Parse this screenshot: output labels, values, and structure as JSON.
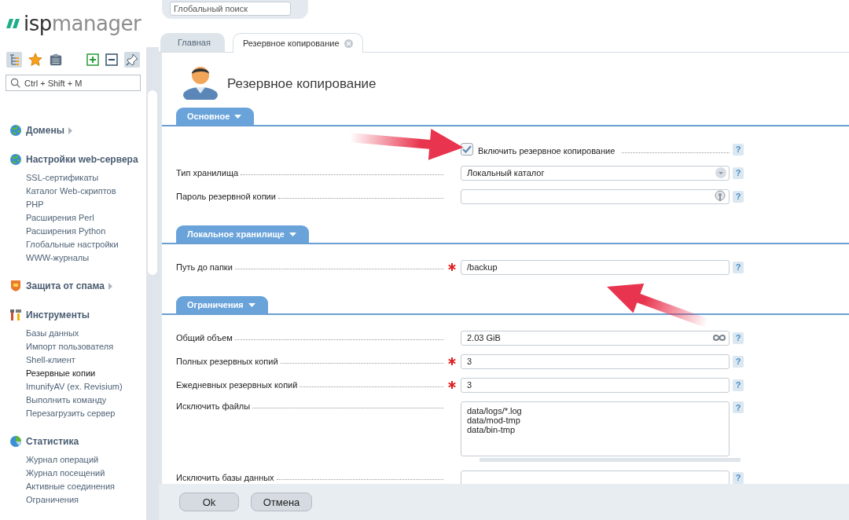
{
  "logo": {
    "accent": "isp",
    "rest": "manager"
  },
  "sidebar": {
    "search": {
      "placeholder": "Ctrl + Shift + M"
    },
    "groups": [
      {
        "title": "Домены",
        "expanded": false
      },
      {
        "title": "Настройки web-сервера",
        "expanded": true,
        "items": [
          {
            "label": "SSL-сертификаты",
            "selected": false
          },
          {
            "label": "Каталог Web-скриптов",
            "selected": false
          },
          {
            "label": "PHP",
            "selected": false
          },
          {
            "label": "Расширения Perl",
            "selected": false
          },
          {
            "label": "Расширения Python",
            "selected": false
          },
          {
            "label": "Глобальные настройки",
            "selected": false
          },
          {
            "label": "WWW-журналы",
            "selected": false
          }
        ]
      },
      {
        "title": "Защита от спама",
        "expanded": false
      },
      {
        "title": "Инструменты",
        "expanded": true,
        "items": [
          {
            "label": "Базы данных",
            "selected": false
          },
          {
            "label": "Импорт пользователя",
            "selected": false
          },
          {
            "label": "Shell-клиент",
            "selected": false
          },
          {
            "label": "Резервные копии",
            "selected": true
          },
          {
            "label": "ImunifyAV (ex. Revisium)",
            "selected": false
          },
          {
            "label": "Выполнить команду",
            "selected": false
          },
          {
            "label": "Перезагрузить сервер",
            "selected": false
          }
        ]
      },
      {
        "title": "Статистика",
        "expanded": true,
        "items": [
          {
            "label": "Журнал операций",
            "selected": false
          },
          {
            "label": "Журнал посещений",
            "selected": false
          },
          {
            "label": "Активные соединения",
            "selected": false
          },
          {
            "label": "Ограничения",
            "selected": false
          }
        ]
      }
    ]
  },
  "global_search": {
    "placeholder": "Глобальный поиск"
  },
  "tabs": [
    {
      "label": "Главная",
      "selected": false,
      "closable": false
    },
    {
      "label": "Резервное копирование",
      "selected": true,
      "closable": true
    }
  ],
  "page_title": "Резервное копирование",
  "sections": [
    {
      "title": "Основное",
      "rows": [
        {
          "kind": "checkbox",
          "label": "Включить резервное копирование",
          "checked": true,
          "required": false,
          "help": "?"
        },
        {
          "kind": "select",
          "label": "Тип хранилища",
          "value": "Локальный каталог",
          "required": false,
          "help": "?"
        },
        {
          "kind": "password",
          "label": "Пароль резервной копии",
          "required": false,
          "help": "?"
        }
      ]
    },
    {
      "title": "Локальное хранилище",
      "rows": [
        {
          "kind": "text",
          "label": "Путь до папки",
          "value": "/backup",
          "required": true,
          "help": "?"
        }
      ]
    },
    {
      "title": "Ограничения",
      "rows": [
        {
          "kind": "size",
          "label": "Общий объем",
          "value": "2.03 GiB",
          "required": false,
          "help": "?"
        },
        {
          "kind": "text",
          "label": "Полных резервных копий",
          "value": "3",
          "required": true,
          "help": "?"
        },
        {
          "kind": "text",
          "label": "Ежедневных резервных копий",
          "value": "3",
          "required": true,
          "help": "?"
        },
        {
          "kind": "textarea",
          "label": "Исключить файлы",
          "value": "data/logs/*.log\ndata/mod-tmp\ndata/bin-tmp",
          "required": false,
          "help": "?"
        },
        {
          "kind": "text",
          "label": "Исключить базы данных",
          "required": false,
          "help": "?"
        }
      ]
    }
  ],
  "buttons": [
    "Ok",
    "Отмена"
  ]
}
